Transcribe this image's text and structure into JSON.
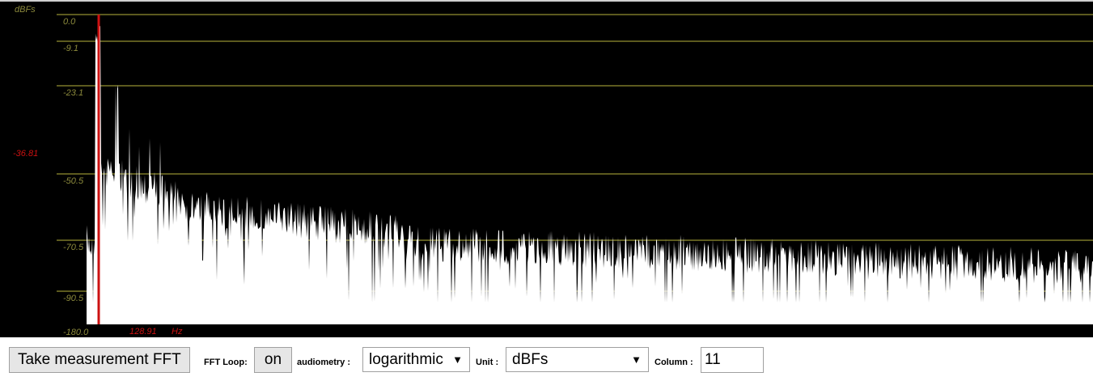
{
  "plot": {
    "unit_label": "dBFs",
    "y_ticks": [
      "0.0",
      "-9.1",
      "-23.1",
      "-50.5",
      "-70.5",
      "-90.5",
      "-180.0"
    ],
    "cursor_db": "-36.81",
    "cursor_freq": "128.91",
    "freq_unit": "Hz",
    "colors": {
      "background": "#000000",
      "grid": "#5c5a1e",
      "tick_text": "#8c8a3c",
      "spectrum": "#ffffff",
      "cursor": "#cc1111"
    }
  },
  "toolbar": {
    "measure_button": "Take measurement FFT",
    "fft_loop_label": "FFT Loop:",
    "fft_loop_button": "on",
    "audiometry_label": "audiometry :",
    "audiometry_value": "logarithmic",
    "unit_label": "Unit :",
    "unit_value": "dBFs",
    "column_label": "Column :",
    "column_value": "11"
  }
}
